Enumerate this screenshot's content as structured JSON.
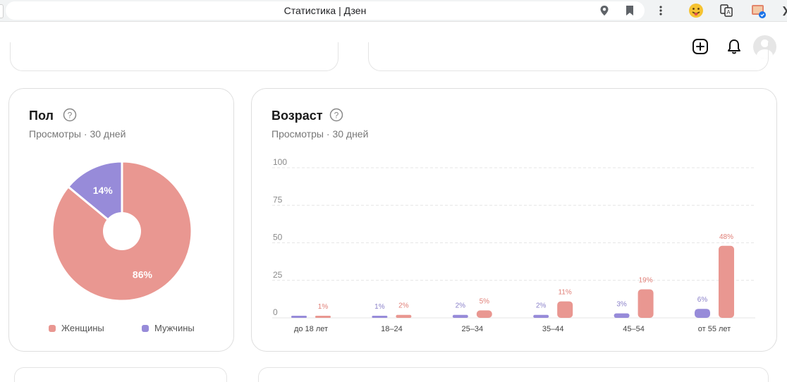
{
  "browser": {
    "tab_title": "Статистика | Дзен"
  },
  "gender_card": {
    "title": "Пол",
    "subtitle": "Просмотры · 30 дней",
    "legend": [
      {
        "label": "Женщины",
        "color": "#e99791"
      },
      {
        "label": "Мужчины",
        "color": "#978bd9"
      }
    ]
  },
  "age_card": {
    "title": "Возраст",
    "subtitle": "Просмотры · 30 дней"
  },
  "colors": {
    "women": "#e99791",
    "men": "#978bd9",
    "women_label": "#e07e76",
    "men_label": "#8a80c9"
  },
  "chart_data": [
    {
      "type": "pie",
      "style": "donut",
      "labels": [
        "Женщины",
        "Мужчины"
      ],
      "values": [
        86,
        14
      ],
      "value_labels": [
        "86%",
        "14%"
      ]
    },
    {
      "type": "bar",
      "categories": [
        "до 18 лет",
        "18–24",
        "25–34",
        "35–44",
        "45–54",
        "от 55 лет"
      ],
      "series": [
        {
          "name": "Мужчины",
          "values": [
            0.5,
            1,
            2,
            2,
            3,
            6
          ],
          "labels": [
            "",
            "1%",
            "2%",
            "2%",
            "3%",
            "6%"
          ]
        },
        {
          "name": "Женщины",
          "values": [
            1,
            2,
            5,
            11,
            19,
            48
          ],
          "labels": [
            "1%",
            "2%",
            "5%",
            "11%",
            "19%",
            "48%"
          ]
        }
      ],
      "yticks": [
        "0",
        "25",
        "50",
        "75",
        "100"
      ],
      "ylim": [
        0,
        100
      ],
      "grid": true
    }
  ]
}
